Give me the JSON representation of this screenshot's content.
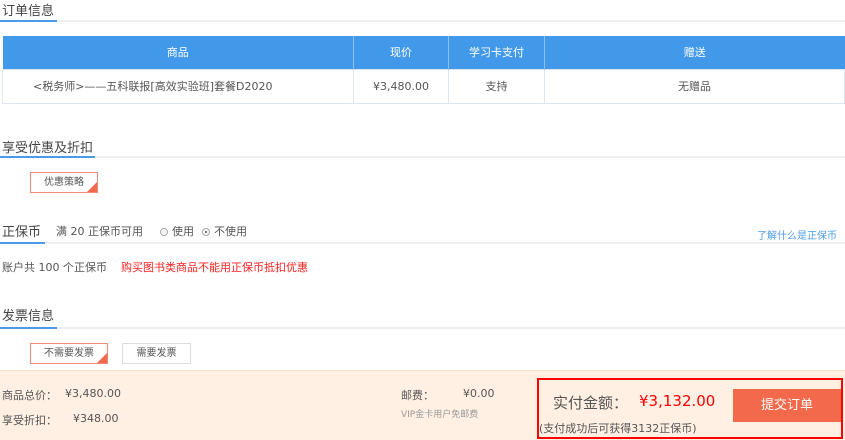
{
  "order": {
    "title": "订单信息",
    "headers": [
      "商品",
      "现价",
      "学习卡支付",
      "赠送"
    ],
    "rows": [
      {
        "product": "<税务师>——五科联报[高效实验班]套餐D2020",
        "price": "¥3,480.00",
        "card_pay": "支持",
        "gift": "无赠品"
      }
    ]
  },
  "discount": {
    "title": "享受优惠及折扣",
    "button": "优惠策略"
  },
  "coins": {
    "title": "正保币",
    "condition": "满 20 正保币可用",
    "use": "使用",
    "not_use": "不使用",
    "selected": "不使用",
    "link": "了解什么是正保币",
    "balance": "账户共 100 个正保币",
    "warning": "购买图书类商品不能用正保币抵扣优惠"
  },
  "invoice": {
    "title": "发票信息",
    "options": [
      "不需要发票",
      "需要发票"
    ],
    "selected": "不需要发票"
  },
  "summary": {
    "total_label": "商品总价：",
    "total": "¥3,480.00",
    "discount_label": "享受折扣：",
    "discount": "¥348.00",
    "shipping_label": "邮费：",
    "shipping": "¥0.00",
    "shipping_note": "VIP金卡用户免邮费",
    "pay_label": "实付金额：",
    "pay": "¥3,132.00",
    "reward": "(支付成功后可获得3132正保币)",
    "submit": "提交订单"
  }
}
